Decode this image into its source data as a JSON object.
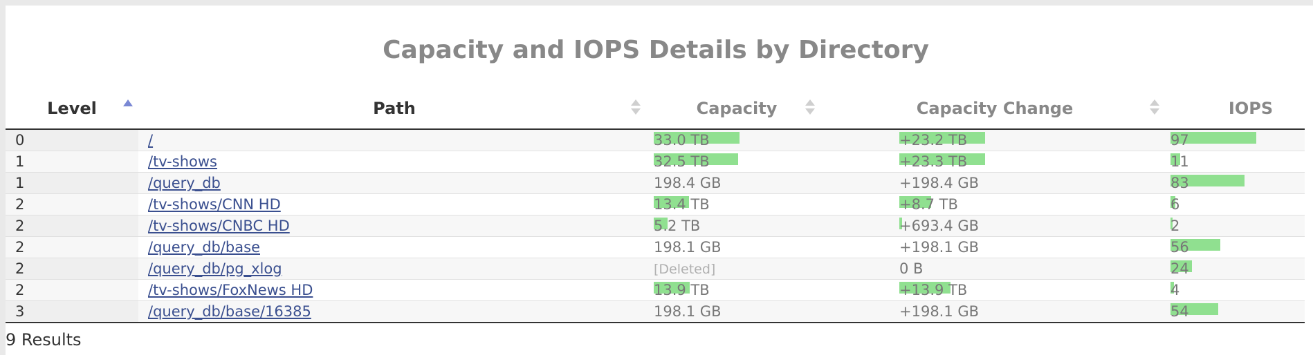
{
  "title": "Capacity and IOPS Details by Directory",
  "columns": {
    "level": "Level",
    "path": "Path",
    "capacity": "Capacity",
    "capacity_change": "Capacity Change",
    "iops": "IOPS"
  },
  "rows": [
    {
      "level": "0",
      "path": "/",
      "capacity": "33.0 TB",
      "capacity_fraction": 1.0,
      "change": "+23.2 TB",
      "change_fraction": 1.0,
      "iops": "97",
      "iops_fraction": 1.0
    },
    {
      "level": "1",
      "path": "/tv-shows",
      "capacity": "32.5 TB",
      "capacity_fraction": 0.98,
      "change": "+23.3 TB",
      "change_fraction": 1.0,
      "iops": "11",
      "iops_fraction": 0.11
    },
    {
      "level": "1",
      "path": "/query_db",
      "capacity": "198.4 GB",
      "capacity_fraction": 0.0,
      "change": "+198.4 GB",
      "change_fraction": 0.0,
      "iops": "83",
      "iops_fraction": 0.86
    },
    {
      "level": "2",
      "path": "/tv-shows/CNN HD",
      "capacity": "13.4 TB",
      "capacity_fraction": 0.41,
      "change": "+8.7 TB",
      "change_fraction": 0.37,
      "iops": "6",
      "iops_fraction": 0.06
    },
    {
      "level": "2",
      "path": "/tv-shows/CNBC HD",
      "capacity": "5.2 TB",
      "capacity_fraction": 0.16,
      "change": "+693.4 GB",
      "change_fraction": 0.03,
      "iops": "2",
      "iops_fraction": 0.02
    },
    {
      "level": "2",
      "path": "/query_db/base",
      "capacity": "198.1 GB",
      "capacity_fraction": 0.0,
      "change": "+198.1 GB",
      "change_fraction": 0.0,
      "iops": "56",
      "iops_fraction": 0.58
    },
    {
      "level": "2",
      "path": "/query_db/pg_xlog",
      "capacity": "[Deleted]",
      "capacity_fraction": 0.0,
      "capacity_deleted": true,
      "change": "0 B",
      "change_fraction": 0.0,
      "iops": "24",
      "iops_fraction": 0.25
    },
    {
      "level": "2",
      "path": "/tv-shows/FoxNews HD",
      "capacity": "13.9 TB",
      "capacity_fraction": 0.42,
      "change": "+13.9 TB",
      "change_fraction": 0.6,
      "iops": "4",
      "iops_fraction": 0.04
    },
    {
      "level": "3",
      "path": "/query_db/base/16385",
      "capacity": "198.1 GB",
      "capacity_fraction": 0.0,
      "change": "+198.1 GB",
      "change_fraction": 0.0,
      "iops": "54",
      "iops_fraction": 0.56
    }
  ],
  "results": "9 Results",
  "colors": {
    "bar": "#90e090",
    "link": "#3a4f8f",
    "title": "#888888",
    "sort_active": "#7a88d4"
  }
}
